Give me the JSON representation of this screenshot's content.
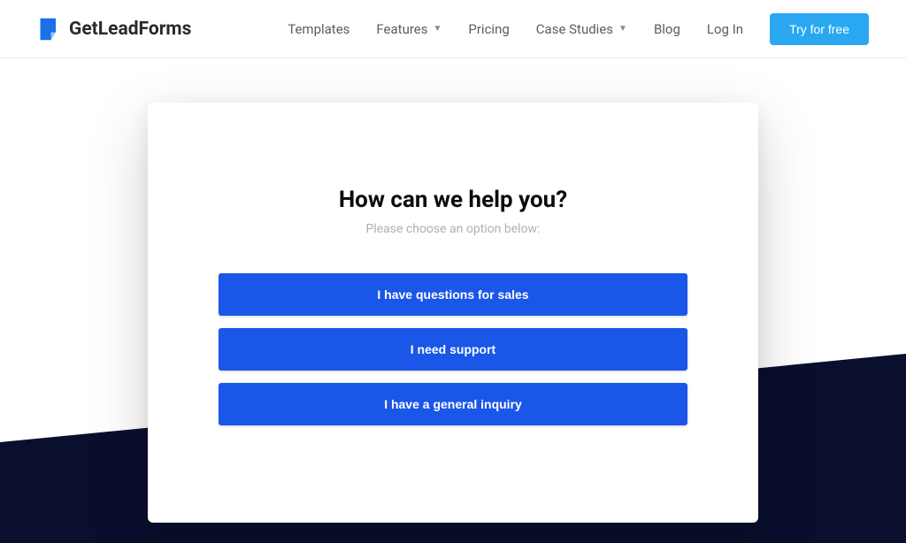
{
  "brand": {
    "name": "GetLeadForms"
  },
  "nav": {
    "items": [
      {
        "label": "Templates",
        "has_dropdown": false
      },
      {
        "label": "Features",
        "has_dropdown": true
      },
      {
        "label": "Pricing",
        "has_dropdown": false
      },
      {
        "label": "Case Studies",
        "has_dropdown": true
      },
      {
        "label": "Blog",
        "has_dropdown": false
      },
      {
        "label": "Log In",
        "has_dropdown": false
      }
    ],
    "cta_label": "Try for free"
  },
  "card": {
    "title": "How can we help you?",
    "subtitle": "Please choose an option below:",
    "options": [
      "I have questions for sales",
      "I need support",
      "I have a general inquiry"
    ]
  },
  "colors": {
    "accent_blue": "#1a56e8",
    "cta_blue": "#29a7f1",
    "dark_navy": "#0a0f2e"
  }
}
